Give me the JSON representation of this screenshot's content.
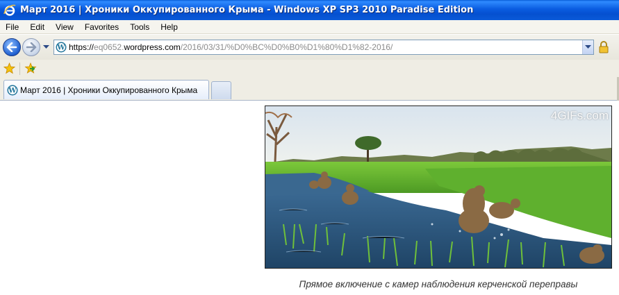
{
  "window": {
    "title": "Март 2016 | Хроники Оккупированного Крыма - Windows XP SP3 2010 Paradise Edition"
  },
  "menu": {
    "items": [
      "File",
      "Edit",
      "View",
      "Favorites",
      "Tools",
      "Help"
    ]
  },
  "address": {
    "scheme": "https://",
    "host_sub": "eq0652.",
    "host_main": "wordpress.com",
    "path": "/2016/03/31/%D0%BC%D0%B0%D1%80%D1%82-2016/"
  },
  "tabs": [
    {
      "label": "Март 2016 | Хроники Оккупированного Крыма"
    }
  ],
  "content": {
    "image_watermark": "4GIFs.com",
    "caption": "Прямое включение с камер наблюдения керченской переправы"
  },
  "colors": {
    "titlebar": "#0a5ce0",
    "chrome": "#efede4",
    "address_border": "#7f9db9"
  }
}
